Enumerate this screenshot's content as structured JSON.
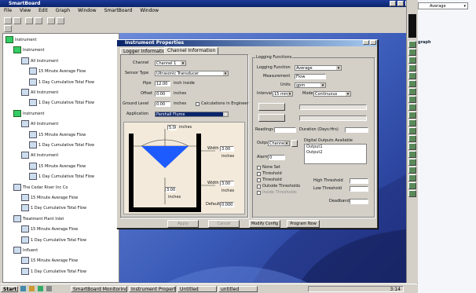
{
  "app": {
    "title": "SmartBoard",
    "menu": [
      "File",
      "View",
      "Edit",
      "Graph",
      "Window",
      "SmartBoard",
      "Window"
    ]
  },
  "tree": {
    "items": [
      {
        "label": "Instrument",
        "indent": 0,
        "icon": "hdr"
      },
      {
        "label": "Instrument",
        "indent": 1,
        "icon": "hdr"
      },
      {
        "label": "All Instrument",
        "indent": 2,
        "icon": "dev"
      },
      {
        "label": "15 Minute Average Flow",
        "indent": 3,
        "icon": "dev"
      },
      {
        "label": "1 Day Cumulative Total Flow",
        "indent": 3,
        "icon": "dev"
      },
      {
        "label": "All Instrument",
        "indent": 2,
        "icon": "dev"
      },
      {
        "label": "1 Day Cumulative Total Flow",
        "indent": 3,
        "icon": "dev"
      },
      {
        "label": "Instrument",
        "indent": 1,
        "icon": "hdr"
      },
      {
        "label": "All Instrument",
        "indent": 2,
        "icon": "dev"
      },
      {
        "label": "15 Minute Average Flow",
        "indent": 3,
        "icon": "dev"
      },
      {
        "label": "1 Day Cumulative Total Flow",
        "indent": 3,
        "icon": "dev"
      },
      {
        "label": "All Instrument",
        "indent": 2,
        "icon": "dev"
      },
      {
        "label": "15 Minute Average Flow",
        "indent": 3,
        "icon": "dev"
      },
      {
        "label": "1 Day Cumulative Total Flow",
        "indent": 3,
        "icon": "dev"
      },
      {
        "label": "The Cedar River Inc Co",
        "indent": 1,
        "icon": "dev"
      },
      {
        "label": "15 Minute Average Flow",
        "indent": 2,
        "icon": "dev"
      },
      {
        "label": "1 Day Cumulative Total Flow",
        "indent": 2,
        "icon": "dev"
      },
      {
        "label": "Treatment Plant Inlet",
        "indent": 1,
        "icon": "dev"
      },
      {
        "label": "15 Minute Average Flow",
        "indent": 2,
        "icon": "dev"
      },
      {
        "label": "1 Day Cumulative Total Flow",
        "indent": 2,
        "icon": "dev"
      },
      {
        "label": "Influent",
        "indent": 1,
        "icon": "dev"
      },
      {
        "label": "15 Minute Average Flow",
        "indent": 2,
        "icon": "dev"
      },
      {
        "label": "1 Day Cumulative Total Flow",
        "indent": 2,
        "icon": "dev"
      }
    ]
  },
  "dialog": {
    "title": "Instrument Properties",
    "tabs": [
      "Logger Information",
      "Channel Information"
    ],
    "channel_label": "Channel",
    "channel_value": "Channel 1",
    "sensor_label": "Sensor Type",
    "sensor_value": "Ultrasonic Transducer",
    "pipe_label": "Pipe",
    "pipe_value": "12.00",
    "pipe_unit": "inch inside",
    "offset_label": "Offset",
    "offset_value": "0.00",
    "offset_unit": "inches",
    "ground_label": "Ground Level",
    "ground_value": "0.00",
    "ground_unit": "inches",
    "units_check": "Calculations in Engineer",
    "application_label": "Application",
    "application_value": "Parshall Flume",
    "diagram": {
      "top_value": "5.00",
      "top_unit": "inches",
      "w1_label": "Width",
      "w1_value": "3.00",
      "w1_unit": "inches",
      "w2_label": "Width",
      "w2_value": "3.00",
      "w2_unit": "inches",
      "depth_value": "3.00",
      "depth_unit": "inches",
      "default_label": "Default",
      "default_value": "0.000"
    },
    "logging_group": "Logging Functions",
    "logging_function_label": "Logging Function",
    "logging_function_value": "Average",
    "measurement_label": "Measurement",
    "measurement_value": "Flow",
    "units_label": "Units",
    "units_value": "gpm",
    "interval_label": "Interval",
    "interval_value": "15 min",
    "mode_label": "Mode",
    "mode_value": "Continuous",
    "readings_label": "Readings",
    "readings_value": "",
    "duration_label": "Duration (Days:Hrs)",
    "duration_value": "",
    "output_label": "Output",
    "output_value": "Channel",
    "digital_group": "Digital Outputs Available",
    "digital_items": [
      "Output1",
      "Output2"
    ],
    "alarm_label": "Alarm",
    "alarm_value": "0",
    "checks": [
      "None Set",
      "Threshold",
      "Threshold",
      "Outside Thresholds",
      "Inside Thresholds"
    ],
    "high_label": "High Threshold",
    "low_label": "Low Threshold",
    "deadband_label": "Deadband",
    "bottom_buttons": [
      "Apply",
      "Cancel",
      "Modify Config",
      "Program Now"
    ]
  },
  "desktop": {
    "dropdown_value": "Average",
    "fragment_text": "graph"
  },
  "taskbar": {
    "start": "Start",
    "tasks": [
      "SmartBoard Monitoring System...",
      "Instrument Properties",
      "Untitled",
      "untitled"
    ],
    "clock": "3:14"
  }
}
